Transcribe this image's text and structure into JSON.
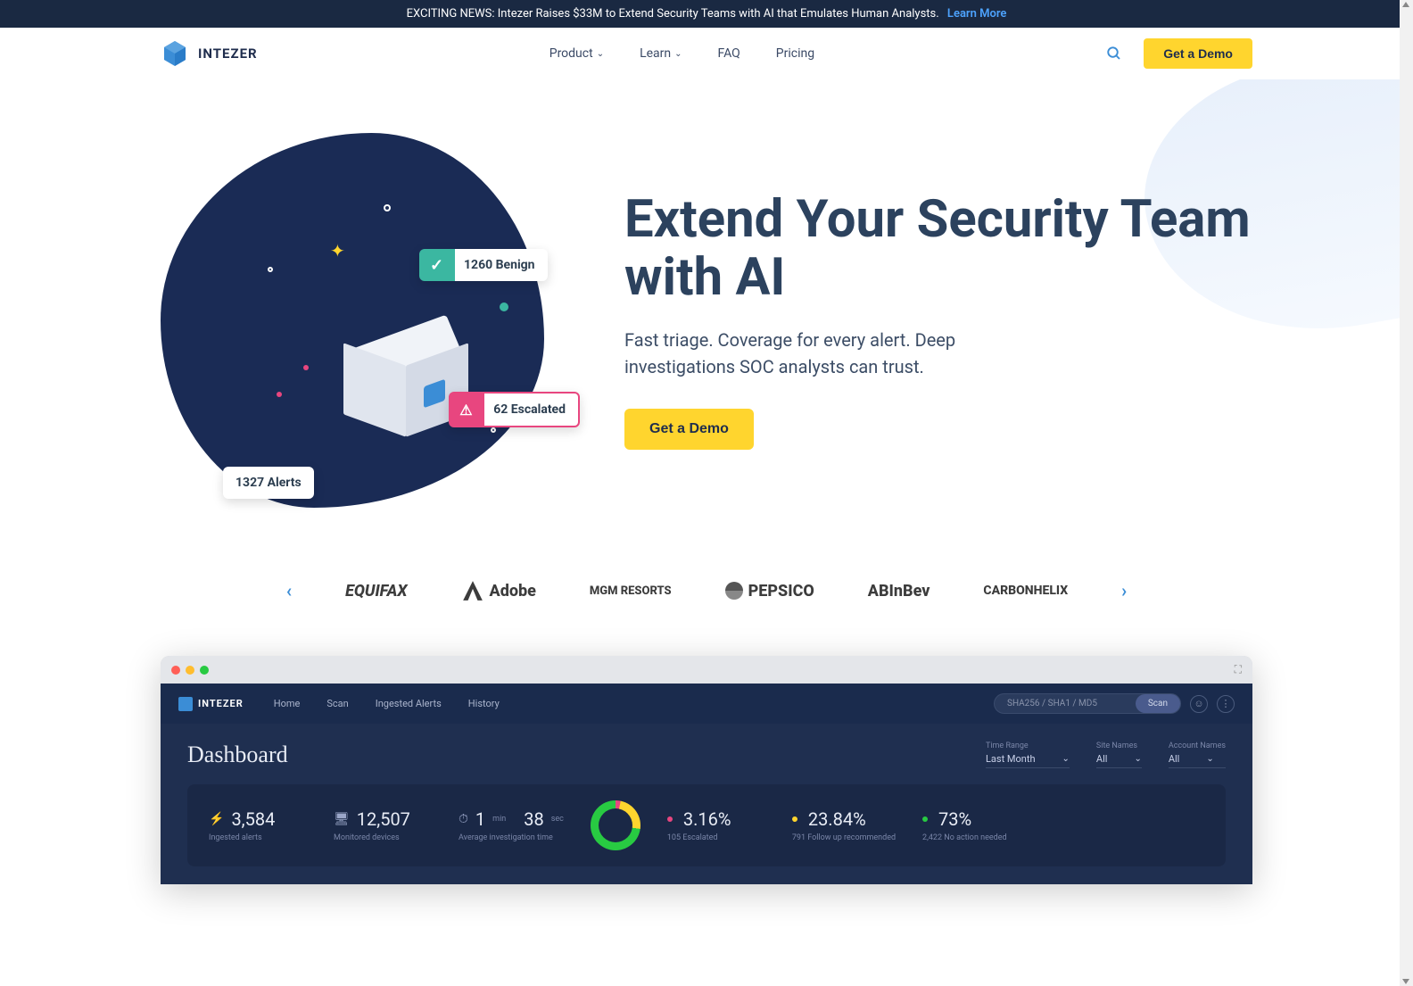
{
  "announcement": {
    "text": "EXCITING NEWS: Intezer Raises $33M to Extend Security Teams with AI that Emulates Human Analysts.",
    "link_text": "Learn More"
  },
  "nav": {
    "brand": "INTEZER",
    "items": [
      "Product",
      "Learn",
      "FAQ",
      "Pricing"
    ],
    "cta": "Get a Demo"
  },
  "hero": {
    "title": "Extend Your Security Team with AI",
    "subtitle": "Fast triage. Coverage for every alert. Deep investigations SOC analysts can trust.",
    "cta": "Get a Demo",
    "badges": {
      "alerts": "1327 Alerts",
      "benign": "1260 Benign",
      "escalated": "62 Escalated"
    }
  },
  "logos": [
    "EQUIFAX",
    "Adobe",
    "MGM RESORTS",
    "PEPSICO",
    "ABInBev",
    "CARBONHELIX"
  ],
  "dashboard": {
    "brand": "INTEZER",
    "tabs": [
      "Home",
      "Scan",
      "Ingested Alerts",
      "History"
    ],
    "search_placeholder": "SHA256 / SHA1 / MD5",
    "scan_btn": "Scan",
    "title": "Dashboard",
    "filters": [
      {
        "label": "Time Range",
        "value": "Last Month"
      },
      {
        "label": "Site Names",
        "value": "All"
      },
      {
        "label": "Account Names",
        "value": "All"
      }
    ],
    "stats": {
      "ingested": {
        "value": "3,584",
        "label": "Ingested alerts"
      },
      "monitored": {
        "value": "12,507",
        "label": "Monitored devices"
      },
      "avg_time": {
        "value_min": "1",
        "unit_min": "min",
        "value_sec": "38",
        "unit_sec": "sec",
        "label": "Average investigation time"
      },
      "pct1": {
        "value": "3.16%",
        "sub": "105 Escalated",
        "color": "#e8467f"
      },
      "pct2": {
        "value": "23.84%",
        "sub": "791 Follow up recommended",
        "color": "#ffd52e"
      },
      "pct3": {
        "value": "73%",
        "sub": "2,422 No action needed",
        "color": "#28ca42"
      }
    }
  }
}
